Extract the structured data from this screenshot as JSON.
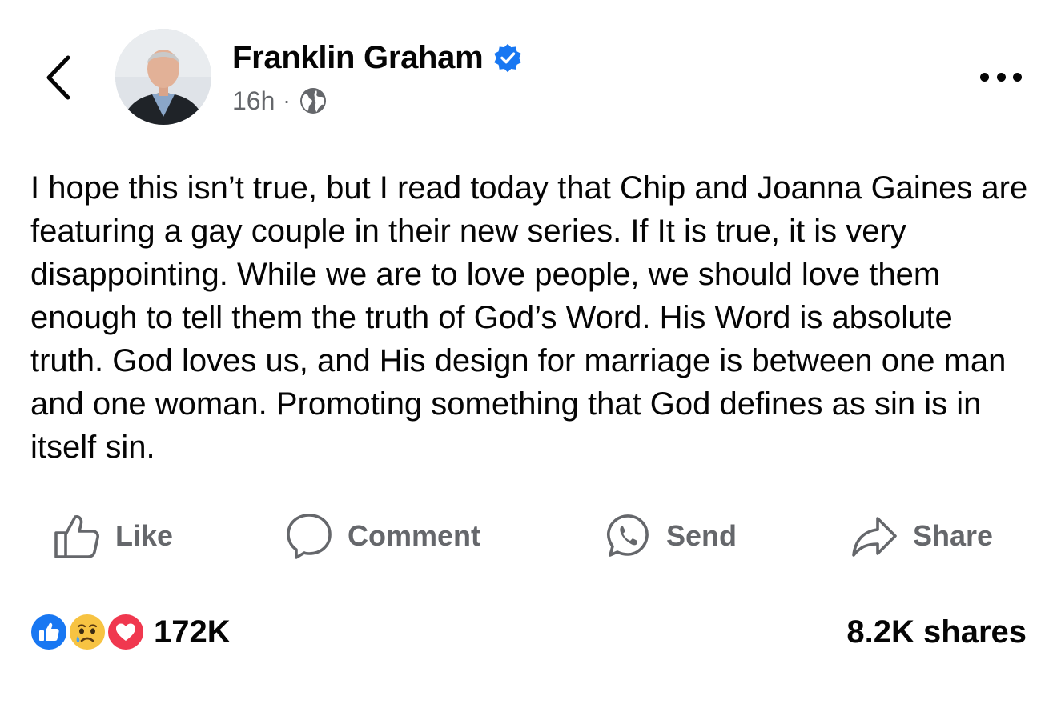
{
  "header": {
    "author_name": "Franklin Graham",
    "time_ago": "16h",
    "separator": "·",
    "audience_icon": "globe-icon",
    "verified_icon": "verified-badge-icon",
    "back_icon": "chevron-left-icon",
    "more_icon": "more-horizontal-icon"
  },
  "post": {
    "text": "I hope this isn’t true, but I read today that Chip and Joanna Gaines are featuring a gay couple in their new series. If It is true, it is very disappointing. While we are to love people, we should love them enough to tell them the truth of God’s Word. His Word is absolute truth. God loves us, and His design for marriage is between one man and one woman. Promoting something that God defines as sin is in itself sin."
  },
  "actions": [
    {
      "label": "Like",
      "icon": "thumbs-up-icon"
    },
    {
      "label": "Comment",
      "icon": "comment-bubble-icon"
    },
    {
      "label": "Send",
      "icon": "whatsapp-icon"
    },
    {
      "label": "Share",
      "icon": "share-arrow-icon"
    }
  ],
  "footer": {
    "reaction_icons": [
      "like-reaction-icon",
      "sad-reaction-icon",
      "love-reaction-icon"
    ],
    "reaction_count": "172K",
    "shares": "8.2K shares"
  },
  "colors": {
    "text": "#050505",
    "secondary": "#65676b",
    "brand_blue": "#1877f2",
    "love_red": "#f0384f",
    "sad_yellow": "#f7c342"
  }
}
